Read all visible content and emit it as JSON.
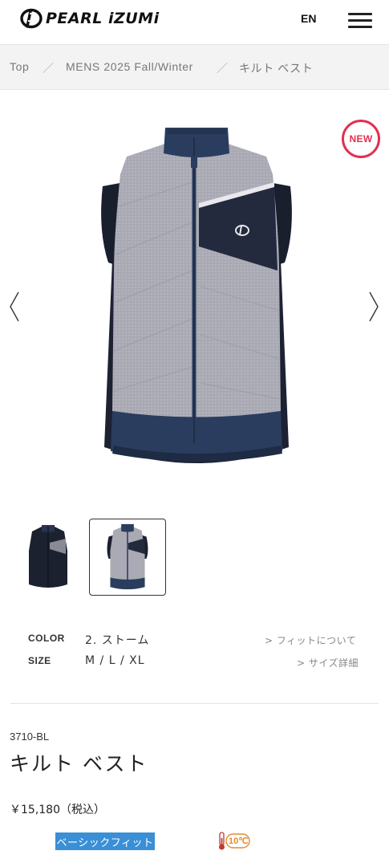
{
  "header": {
    "brand": "PEARL iZUMi",
    "lang_label": "EN"
  },
  "breadcrumb": {
    "items": [
      "Top",
      "MENS 2025 Fall/Winter",
      "キルト ベスト"
    ],
    "separator": "／"
  },
  "gallery": {
    "new_badge": "NEW",
    "thumbnails": [
      {
        "name": "black",
        "active": false
      },
      {
        "name": "storm",
        "active": true
      }
    ]
  },
  "specs": {
    "color_label": "COLOR",
    "color_value": "2. ストーム",
    "fit_link": "> フィットについて",
    "size_label": "SIZE",
    "size_value": "M / L / XL",
    "size_link": "> サイズ詳細"
  },
  "product": {
    "sku": "3710-BL",
    "title": "キルト ベスト",
    "price": "￥15,180（税込）",
    "fit_badge": "ベーシックフィット",
    "temp_badge": "10℃"
  },
  "colors": {
    "accent_red": "#e3304f",
    "fit_blue": "#3a8fd6",
    "temp_orange": "#e58a2e"
  }
}
